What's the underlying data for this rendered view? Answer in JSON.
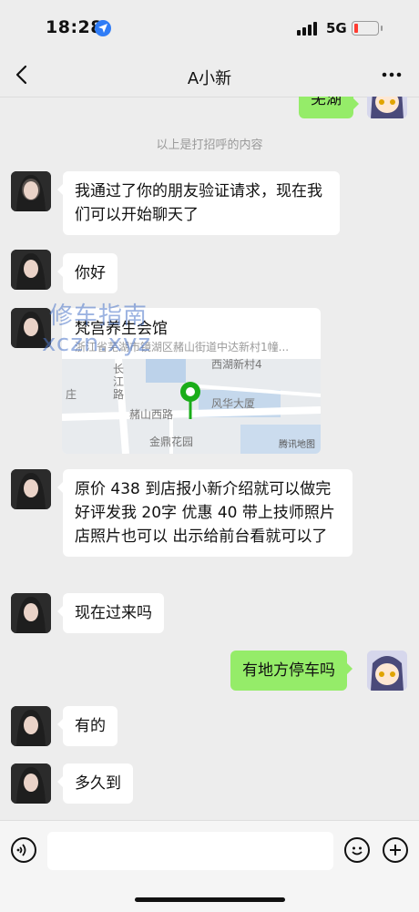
{
  "status": {
    "time": "18:28",
    "network": "5G"
  },
  "nav": {
    "title": "A小新"
  },
  "chat": {
    "top_partial_message": "芜湖",
    "system_note": "以上是打招呼的内容",
    "messages": [
      {
        "from": "her",
        "text": "我通过了你的朋友验证请求，现在我们可以开始聊天了"
      },
      {
        "from": "her",
        "text": "你好"
      },
      {
        "from": "her",
        "type": "location"
      },
      {
        "from": "her",
        "text": "原价 438 到店报小新介绍就可以做完好评发我 20字 优惠 40  带上技师照片 店照片也可以  出示给前台看就可以了"
      },
      {
        "from": "her",
        "text": "现在过来吗"
      },
      {
        "from": "me",
        "text": "有地方停车吗"
      },
      {
        "from": "her",
        "text": "有的"
      },
      {
        "from": "her",
        "text": "多久到"
      }
    ],
    "location": {
      "name": "梵宫养生会馆",
      "address": "浙江省芜湖市镜湖区赭山街道中达新村1幢...",
      "map_labels": [
        "长江路",
        "庄",
        "赭山西路",
        "风华大厦",
        "金鼎花园",
        "腾讯地图",
        "西湖新村4"
      ]
    },
    "watermark": [
      "修车指南",
      "xczn.xyz"
    ]
  },
  "colors": {
    "outgoing_bubble": "#95ec69",
    "incoming_bubble": "#ffffff",
    "background": "#ededed",
    "map_pin": "#1aad19"
  }
}
